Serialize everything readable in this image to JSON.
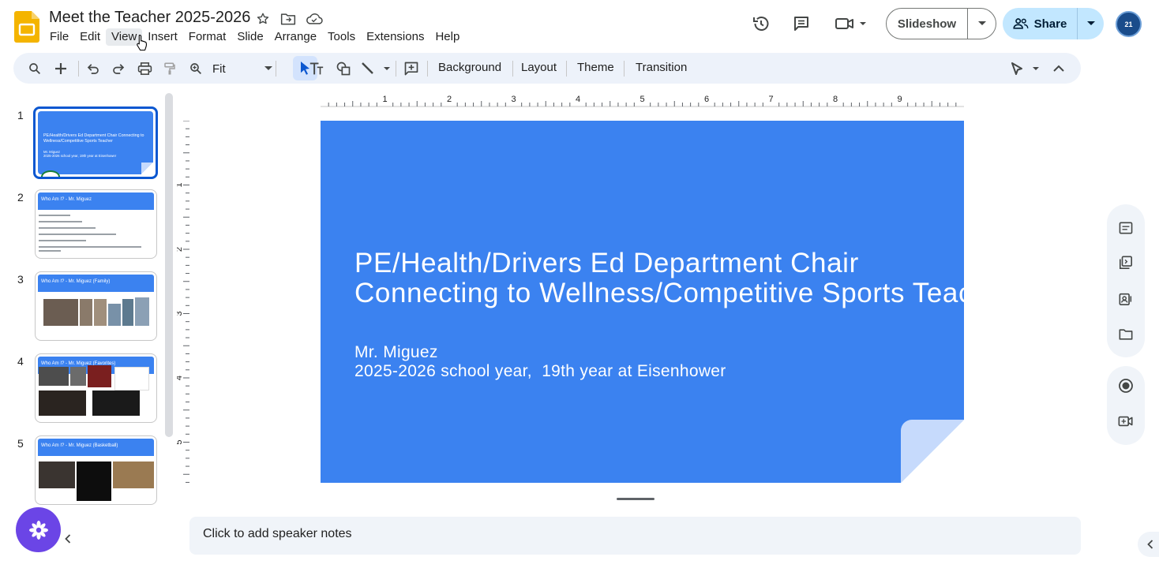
{
  "app": {
    "title": "Meet the Teacher 2025-2026",
    "accent": "#f4b400"
  },
  "menu": [
    "File",
    "Edit",
    "View",
    "Insert",
    "Format",
    "Slide",
    "Arrange",
    "Tools",
    "Extensions",
    "Help"
  ],
  "header": {
    "slideshow_label": "Slideshow",
    "share_label": "Share",
    "avatar_label": "21"
  },
  "toolbar": {
    "zoom_value": "Fit",
    "background_label": "Background",
    "layout_label": "Layout",
    "theme_label": "Theme",
    "transition_label": "Transition"
  },
  "ruler": {
    "h_marks": [
      "1",
      "2",
      "3",
      "4",
      "5",
      "6",
      "7",
      "8",
      "9"
    ],
    "v_marks": [
      "1",
      "2",
      "3",
      "4",
      "5"
    ]
  },
  "slides": [
    {
      "number": "1",
      "title": "PE/Health/Drivers Ed Department Chair Connecting to Wellness/Competitive Sports Teacher",
      "line1": "Mr. Miguez",
      "line2": "2025-2026 school year, 19th year at Eisenhower"
    },
    {
      "number": "2",
      "title": "Who Am I? - Mr. Miguez"
    },
    {
      "number": "3",
      "title": "Who Am I? - Mr. Miguez (Family)"
    },
    {
      "number": "4",
      "title": "Who Am I? - Mr. Miguez (Favorites)"
    },
    {
      "number": "5",
      "title": "Who Am I? - Mr. Miguez (Basketball)"
    }
  ],
  "current_slide": {
    "title_line1": "PE/Health/Drivers Ed Department Chair",
    "title_line2": "Connecting to Wellness/Competitive Sports Teacher",
    "subtitle_line1": "Mr. Miguez",
    "subtitle_line2": "2025-2026 school year,  19th year at Eisenhower",
    "background_color": "#3b82f0"
  },
  "notes": {
    "placeholder": "Click to add speaker notes"
  },
  "side_panel": [
    "keep-notes-icon",
    "copy-icon",
    "contacts-icon",
    "folder-icon",
    "record-icon",
    "video-call-icon"
  ]
}
